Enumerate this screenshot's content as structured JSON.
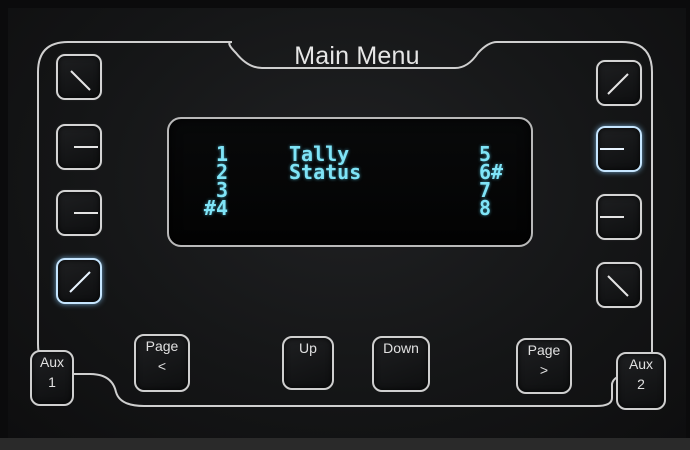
{
  "header": {
    "title": "Main Menu"
  },
  "display": {
    "rows": [
      {
        "left": "1",
        "center": "Tally",
        "right": "5"
      },
      {
        "left": "2",
        "center": "Status",
        "right": "6#"
      },
      {
        "left": "3",
        "center": "",
        "right": "7"
      },
      {
        "left": "#4",
        "center": "",
        "right": "8"
      }
    ]
  },
  "softkeys": {
    "left": [
      "diagonal-down-icon",
      "tee-right-icon",
      "tee-right-icon",
      "diagonal-up-icon"
    ],
    "right": [
      "diagonal-up-icon",
      "tee-left-icon",
      "tee-left-icon",
      "diagonal-down-icon"
    ]
  },
  "buttons": {
    "aux1": {
      "line1": "Aux",
      "line2": "1"
    },
    "page_prev": {
      "line1": "Page",
      "line2": "<"
    },
    "up": {
      "line1": "Up"
    },
    "down": {
      "line1": "Down"
    },
    "page_next": {
      "line1": "Page",
      "line2": ">"
    },
    "aux2": {
      "line1": "Aux",
      "line2": "2"
    }
  },
  "colors": {
    "oled_text": "#7fe4f7",
    "panel": "#17181a",
    "outline": "#d8d8d8",
    "lit_glow": "#8ccdff"
  }
}
